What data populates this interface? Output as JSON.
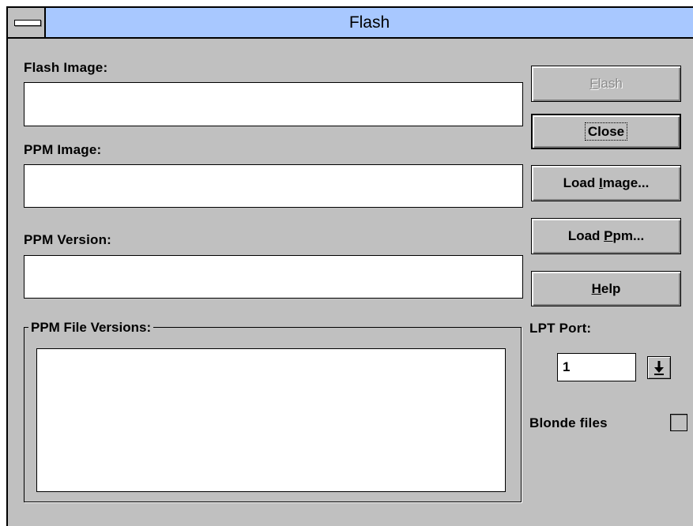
{
  "window": {
    "title": "Flash"
  },
  "flash_image": {
    "label": "Flash Image:",
    "value": ""
  },
  "ppm_image": {
    "label": "PPM Image:",
    "value": ""
  },
  "ppm_version": {
    "label": "PPM Version:",
    "value": ""
  },
  "ppm_file_versions": {
    "label": "PPM File Versions:",
    "items": []
  },
  "buttons": {
    "flash": {
      "pre": "",
      "accel": "F",
      "post": "lash",
      "disabled": true
    },
    "close": {
      "label": "Close"
    },
    "load_image": {
      "pre": "Load ",
      "accel": "I",
      "post": "mage..."
    },
    "load_ppm": {
      "pre": "Load ",
      "accel": "P",
      "post": "pm..."
    },
    "help": {
      "pre": "",
      "accel": "H",
      "post": "elp"
    }
  },
  "lpt_port": {
    "label": "LPT Port:",
    "value": "1"
  },
  "blonde_files": {
    "label": "Blonde files",
    "checked": false
  },
  "icons": {
    "system_menu": "system-menu-icon",
    "dropdown": "arrow-down-icon"
  }
}
